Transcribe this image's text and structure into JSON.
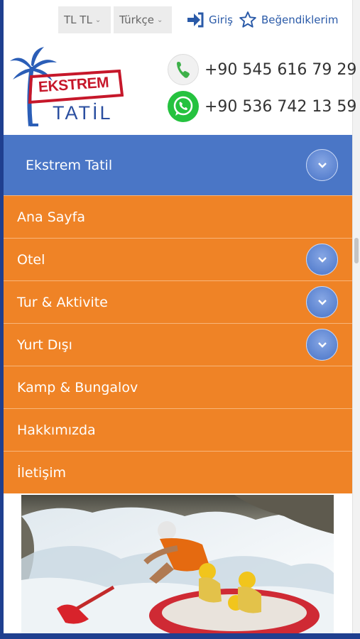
{
  "topbar": {
    "currency": "TL TL",
    "language": "Türkçe",
    "login": "Giriş",
    "favorites": "Beğendiklerim"
  },
  "logo": {
    "line1": "EKSTREM",
    "line2": "TATİL"
  },
  "contact": {
    "phone": "+90 545 616 79 29",
    "whatsapp": "+90 536 742 13 59"
  },
  "nav": {
    "title": "Ekstrem Tatil",
    "items": [
      {
        "label": "Ana Sayfa",
        "has_toggle": false
      },
      {
        "label": "Otel",
        "has_toggle": true
      },
      {
        "label": "Tur & Aktivite",
        "has_toggle": true
      },
      {
        "label": "Yurt Dışı",
        "has_toggle": true
      },
      {
        "label": "Kamp & Bungalov",
        "has_toggle": false
      },
      {
        "label": "Hakkımızda",
        "has_toggle": false
      },
      {
        "label": "İletişim",
        "has_toggle": false
      }
    ]
  },
  "colors": {
    "nav_header": "#4a76c6",
    "nav_item": "#ef8326",
    "link": "#2a5aa8",
    "whatsapp": "#25c23f"
  },
  "icons": {
    "login": "login-arrow-icon",
    "favorites": "star-outline-icon",
    "phone": "phone-icon",
    "whatsapp": "whatsapp-icon",
    "toggle": "chevron-down-icon"
  }
}
